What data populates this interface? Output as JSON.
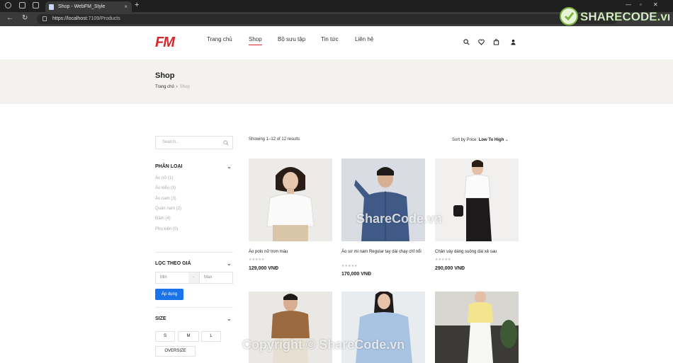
{
  "browser": {
    "tab_title": "Shop - WebFM_Style",
    "url_host": "https://localhost",
    "url_rest": ":7109/Products",
    "new_tab": "+",
    "close": "×"
  },
  "header": {
    "logo": "FM",
    "menu": [
      "Trang chủ",
      "Shop",
      "Bộ sưu tập",
      "Tin tức",
      "Liên hệ"
    ],
    "active_menu": "Shop"
  },
  "hero": {
    "title": "Shop",
    "breadcrumb_home": "Trang chủ",
    "breadcrumb_sep": "›",
    "breadcrumb_current": "Shop"
  },
  "sidebar": {
    "search_placeholder": "Search...",
    "category_title": "PHÂN LOẠI",
    "categories": [
      "Áo nữ (1)",
      "Áo kiểu (3)",
      "Áo nam (3)",
      "Quần nam (2)",
      "Đầm (4)",
      "Phụ kiện (0)"
    ],
    "price_title": "LỌC THEO GIÁ",
    "price_min_placeholder": "Min",
    "price_dash": "-",
    "price_max_placeholder": "Max",
    "apply_label": "Áp dụng",
    "size_title": "SIZE",
    "sizes": [
      "S",
      "M",
      "L",
      "OVERSIZE"
    ]
  },
  "products_header": {
    "showing": "Showing 1–12 of 12 results",
    "sort_prefix": "Sort by Price:",
    "sort_value": "Low To High"
  },
  "products": [
    {
      "name": "Áo polo nữ trơn màu",
      "price": "129,000 VNĐ",
      "stars": "★★★★★"
    },
    {
      "name": "Áo sơ mi nam Regular tay dài chạy chỉ nổi",
      "price": "170,000 VNĐ",
      "stars": "★★★★★"
    },
    {
      "name": "Chân váy dáng suông dài xẻ sau",
      "price": "290,000 VNĐ",
      "stars": "★★★★★"
    }
  ],
  "watermarks": {
    "center": "ShareCode.vn",
    "copyright": "Copyright © ShareCode.vn",
    "logo": "SHARECODE.vn"
  },
  "colors": {
    "brand": "#d7262d",
    "apply": "#1a73e8",
    "hero_bg": "#f3f2ef"
  }
}
